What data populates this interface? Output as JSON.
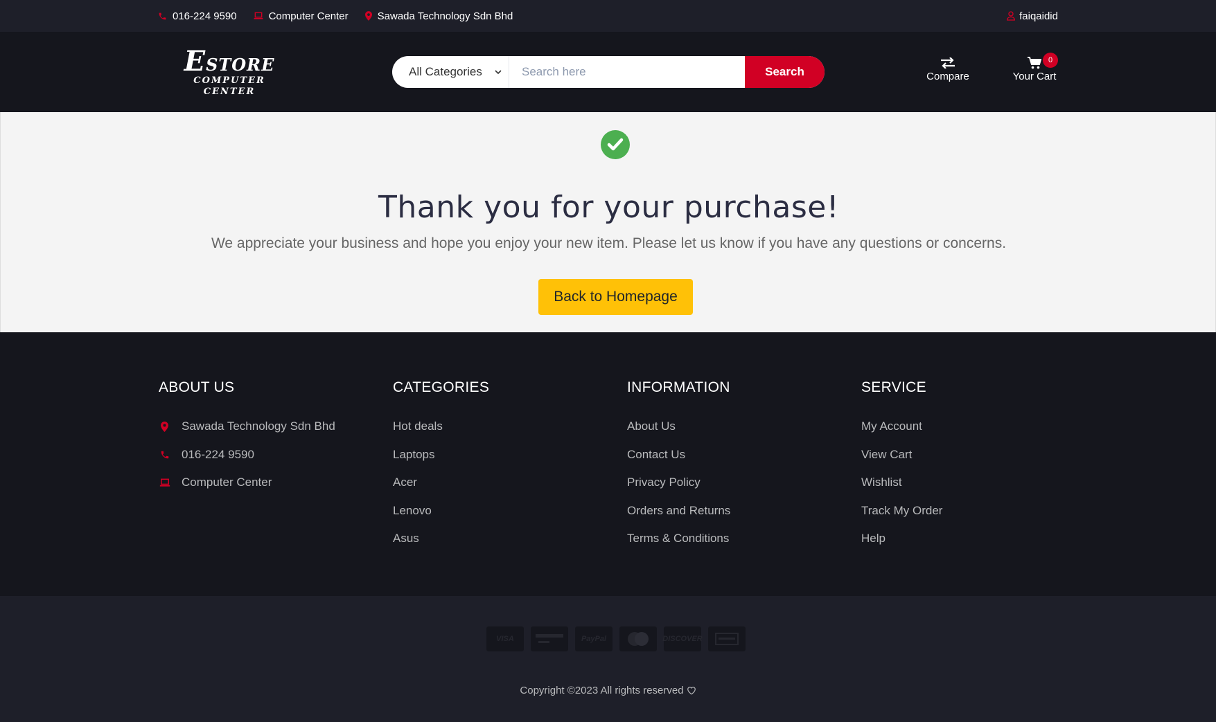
{
  "topbar": {
    "phone": "016-224 9590",
    "store_label": "Computer Center",
    "company": "Sawada Technology Sdn Bhd",
    "user": "faiqaidid"
  },
  "header": {
    "logo_line1_initial": "E",
    "logo_line1_rest": "STORE",
    "logo_line2": "COMPUTER CENTER",
    "category_selected": "All Categories",
    "search_placeholder": "Search here",
    "search_button": "Search",
    "compare_label": "Compare",
    "cart_label": "Your Cart",
    "cart_count": "0"
  },
  "main": {
    "title": "Thank you for your purchase!",
    "message": "We appreciate your business and hope you enjoy your new item. Please let us know if you have any questions or concerns.",
    "back_button": "Back to Homepage"
  },
  "footer": {
    "about": {
      "heading": "ABOUT US",
      "items": [
        "Sawada Technology Sdn Bhd",
        "016-224 9590",
        "Computer Center"
      ]
    },
    "categories": {
      "heading": "CATEGORIES",
      "items": [
        "Hot deals",
        "Laptops",
        "Acer",
        "Lenovo",
        "Asus"
      ]
    },
    "information": {
      "heading": "INFORMATION",
      "items": [
        "About Us",
        "Contact Us",
        "Privacy Policy",
        "Orders and Returns",
        "Terms & Conditions"
      ]
    },
    "service": {
      "heading": "SERVICE",
      "items": [
        "My Account",
        "View Cart",
        "Wishlist",
        "Track My Order",
        "Help"
      ]
    }
  },
  "bottom": {
    "payment_cards": [
      "VISA",
      "",
      "PayPal",
      "",
      "DISCOVER",
      ""
    ],
    "copyright": "Copyright ©2023 All rights reserved"
  },
  "colors": {
    "accent": "#d10024",
    "dark": "#15161d",
    "darker": "#1e1f29",
    "success": "#4caf50",
    "button_yellow": "#ffc107"
  }
}
